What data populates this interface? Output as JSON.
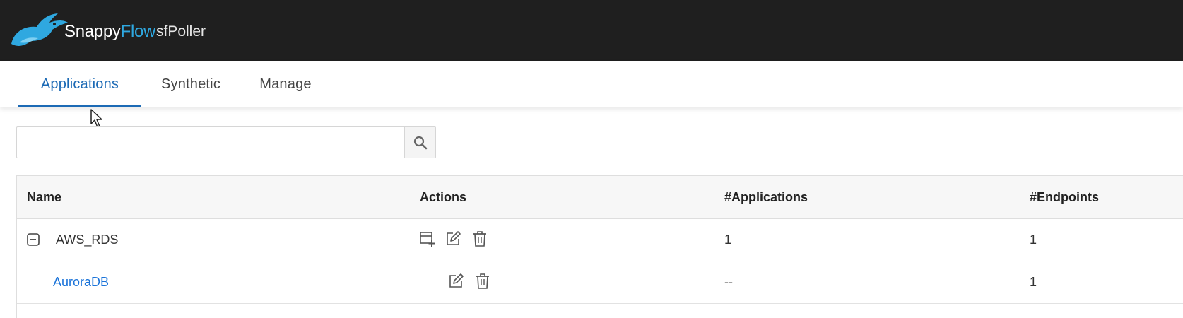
{
  "header": {
    "brand_part1": "Snappy",
    "brand_part2": "Flow",
    "product": "sfPoller",
    "logo_icon": "rabbit-logo-icon",
    "brand_accent": "#2fa8e0",
    "background": "#1f1f1f"
  },
  "tabs": [
    {
      "label": "Applications",
      "active": true
    },
    {
      "label": "Synthetic",
      "active": false
    },
    {
      "label": "Manage",
      "active": false
    }
  ],
  "search": {
    "placeholder": "",
    "value": "",
    "icon": "search-icon"
  },
  "table": {
    "columns": [
      "Name",
      "Actions",
      "#Applications",
      "#Endpoints"
    ],
    "rows": [
      {
        "name": "AWS_RDS",
        "expanded": true,
        "actions": [
          "add-endpoint-icon",
          "edit-icon",
          "delete-icon"
        ],
        "applications": "1",
        "endpoints": "1"
      },
      {
        "name": "AuroraDB",
        "child": true,
        "actions": [
          "edit-icon",
          "delete-icon"
        ],
        "applications": "--",
        "endpoints": "1"
      }
    ]
  },
  "colors": {
    "accent": "#1c6ab5",
    "link": "#1a73d9"
  }
}
